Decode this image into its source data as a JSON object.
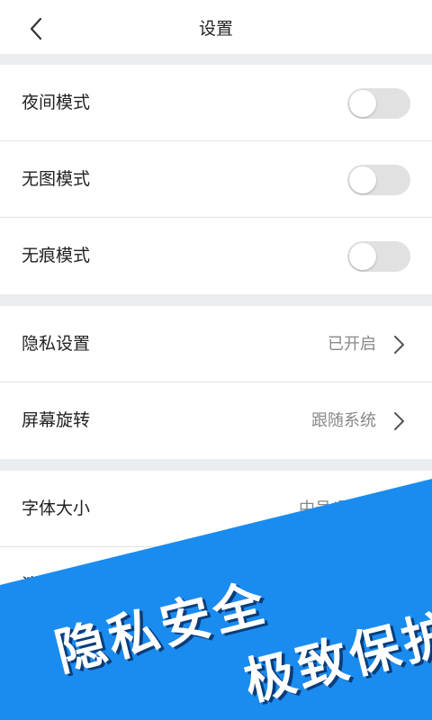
{
  "header": {
    "title": "设置"
  },
  "toggles": [
    {
      "label": "夜间模式",
      "on": false
    },
    {
      "label": "无图模式",
      "on": false
    },
    {
      "label": "无痕模式",
      "on": false
    }
  ],
  "links": [
    {
      "label": "隐私设置",
      "value": "已开启"
    },
    {
      "label": "屏幕旋转",
      "value": "跟随系统"
    }
  ],
  "font_row": {
    "label": "字体大小",
    "value": "中号(默认)"
  },
  "clear_row": {
    "label": "清除"
  },
  "promo": {
    "line1": "隐私安全",
    "line2": "极致保护",
    "color": "#1a8cf0"
  },
  "colors": {
    "gap": "#ebeef1",
    "toggle_off": "#e1e1e1",
    "value_text": "#888888"
  }
}
